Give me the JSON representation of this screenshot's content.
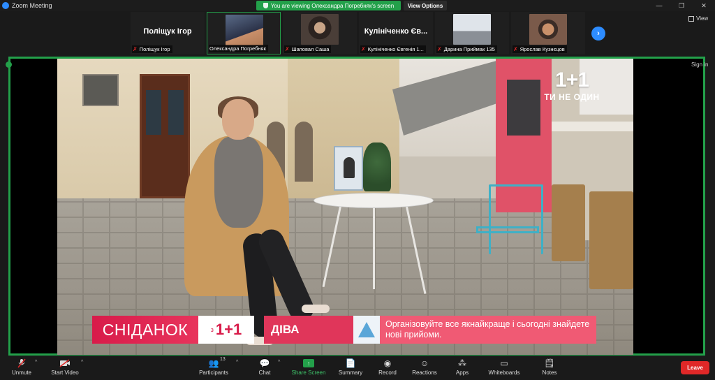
{
  "window": {
    "title": "Zoom Meeting",
    "share_banner": "You are viewing Олександра Погребняк's screen",
    "view_options": "View Options",
    "controls": [
      "—",
      "❐",
      "✕"
    ]
  },
  "strip": {
    "tiles": [
      {
        "display": "Поліщук Ігор",
        "label": "Поліщук Ігор",
        "muted": true,
        "has_video": false
      },
      {
        "display": "",
        "label": "Олександра Погребняк",
        "muted": false,
        "has_video": true,
        "active": true
      },
      {
        "display": "",
        "label": "Шаповал Саша",
        "muted": true,
        "has_video": true
      },
      {
        "display": "Кулініченко Єв...",
        "label": "Кулініченко Євгенія 1...",
        "muted": true,
        "has_video": false
      },
      {
        "display": "",
        "label": "Дарина Приймак 135",
        "muted": true,
        "has_video": true
      },
      {
        "display": "",
        "label": "Ярослав Кузнєцов",
        "muted": true,
        "has_video": true
      }
    ],
    "next_icon": "›",
    "view_label": "View"
  },
  "share": {
    "signin": "Sign in",
    "brand_logo": "1+1",
    "brand_tag": "ТИ НЕ ОДИН",
    "lower_third": {
      "show": "СНІДАНОК",
      "channel_prefix": "з",
      "channel": "1+1",
      "segment": "ДІВА",
      "text": "Організовуйте все якнайкраще і сьогодні знайдете нові прийоми."
    }
  },
  "toolbar": {
    "unmute": "Unmute",
    "start_video": "Start Video",
    "participants": "Participants",
    "participants_count": "13",
    "chat": "Chat",
    "share_screen": "Share Screen",
    "summary": "Summary",
    "record": "Record",
    "reactions": "Reactions",
    "apps": "Apps",
    "whiteboards": "Whiteboards",
    "notes": "Notes",
    "leave": "Leave"
  },
  "colors": {
    "accent_green": "#23a04a",
    "leave_red": "#e02828",
    "zoom_blue": "#2d8cff",
    "brand_pink": "#e0365a"
  }
}
